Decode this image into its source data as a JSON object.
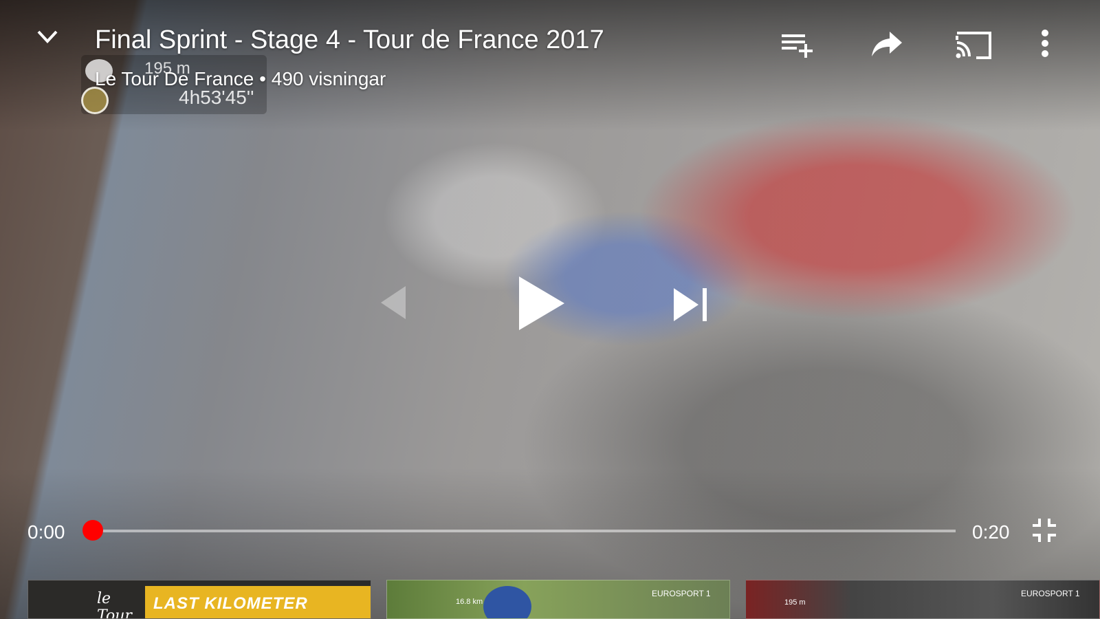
{
  "video": {
    "title": "Final Sprint - Stage 4 - Tour de France 2017",
    "channel_line": "Le Tour De France • 490 visningar",
    "overlay": {
      "distance": "195 m",
      "race_time": "4h53'45''"
    }
  },
  "header": {
    "collapse_icon": "chevron-down-icon",
    "actions": [
      {
        "name": "add-to-playlist",
        "icon": "playlist-add-icon"
      },
      {
        "name": "share",
        "icon": "share-arrow-icon"
      },
      {
        "name": "cast",
        "icon": "cast-icon"
      },
      {
        "name": "more",
        "icon": "more-vertical-icon"
      }
    ]
  },
  "player": {
    "current_time": "0:00",
    "duration": "0:20",
    "progress_fraction": 0.0,
    "accent_color": "#ff0000"
  },
  "related": [
    {
      "banner_text": "LAST KILOMETER",
      "logo_text": "le Tour"
    },
    {
      "dist_text": "16.8 km",
      "tag": "EUROSPORT 1"
    },
    {
      "dist_text": "195 m",
      "tag": "EUROSPORT 1"
    }
  ]
}
